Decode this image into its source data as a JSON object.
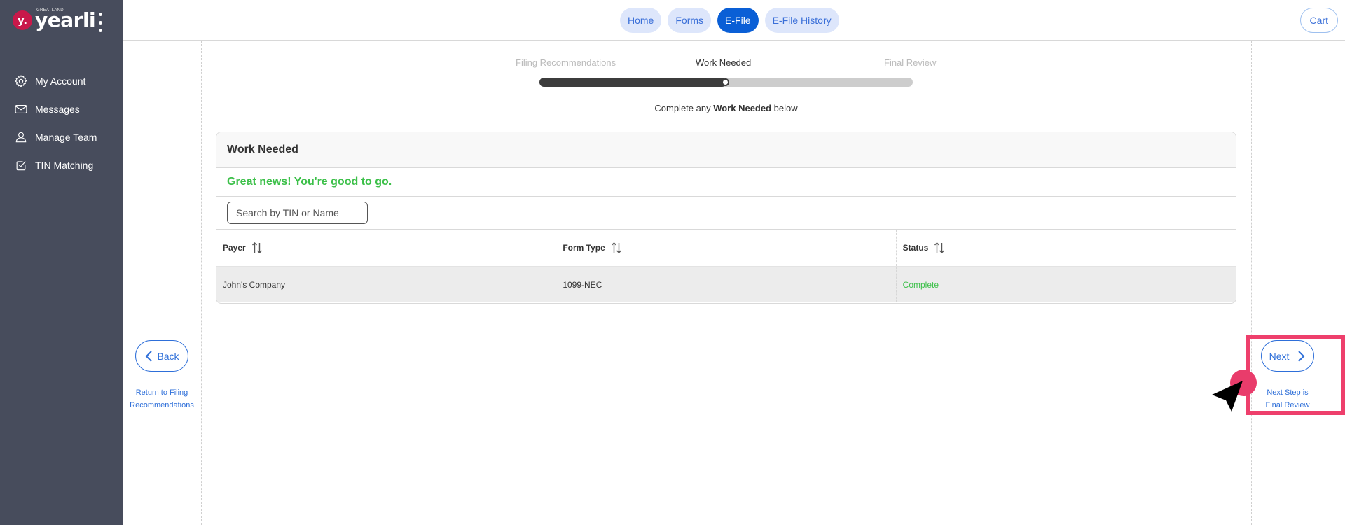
{
  "brand": {
    "badge": "y.",
    "sub": "GREATLAND",
    "name": "yearli",
    "color": "#c9184a"
  },
  "sidebar": {
    "items": [
      {
        "label": "My Account",
        "icon": "gear-icon"
      },
      {
        "label": "Messages",
        "icon": "envelope-icon"
      },
      {
        "label": "Manage Team",
        "icon": "person-icon"
      },
      {
        "label": "TIN Matching",
        "icon": "checkbox-icon"
      }
    ]
  },
  "topnav": {
    "tabs": [
      {
        "label": "Home",
        "active": false
      },
      {
        "label": "Forms",
        "active": false
      },
      {
        "label": "E-File",
        "active": true
      },
      {
        "label": "E-File History",
        "active": false
      }
    ],
    "cart_label": "Cart"
  },
  "stepper": {
    "steps": [
      "Filing Recommendations",
      "Work Needed",
      "Final Review"
    ],
    "current_step": "Work Needed",
    "progress_percent": 50,
    "instruction_prefix": "Complete any ",
    "instruction_bold": "Work Needed",
    "instruction_suffix": " below"
  },
  "panel": {
    "title": "Work Needed",
    "status_message": "Great news! You're good to go.",
    "search_placeholder": "Search by TIN or Name",
    "columns": [
      "Payer",
      "Form Type",
      "Status"
    ],
    "rows": [
      {
        "payer": "John's Company",
        "form_type": "1099-NEC",
        "status": "Complete"
      }
    ]
  },
  "navigation": {
    "back_label": "Back",
    "back_caption_line1": "Return to Filing",
    "back_caption_line2": "Recommendations",
    "next_label": "Next",
    "next_caption_line1": "Next Step is",
    "next_caption_line2": "Final Review"
  },
  "colors": {
    "sidebar_bg": "#474c5c",
    "accent_blue": "#0a5fd6",
    "link_blue": "#2e6fd9",
    "success_green": "#3dc04a",
    "highlight_pink": "#ee3f6c"
  }
}
